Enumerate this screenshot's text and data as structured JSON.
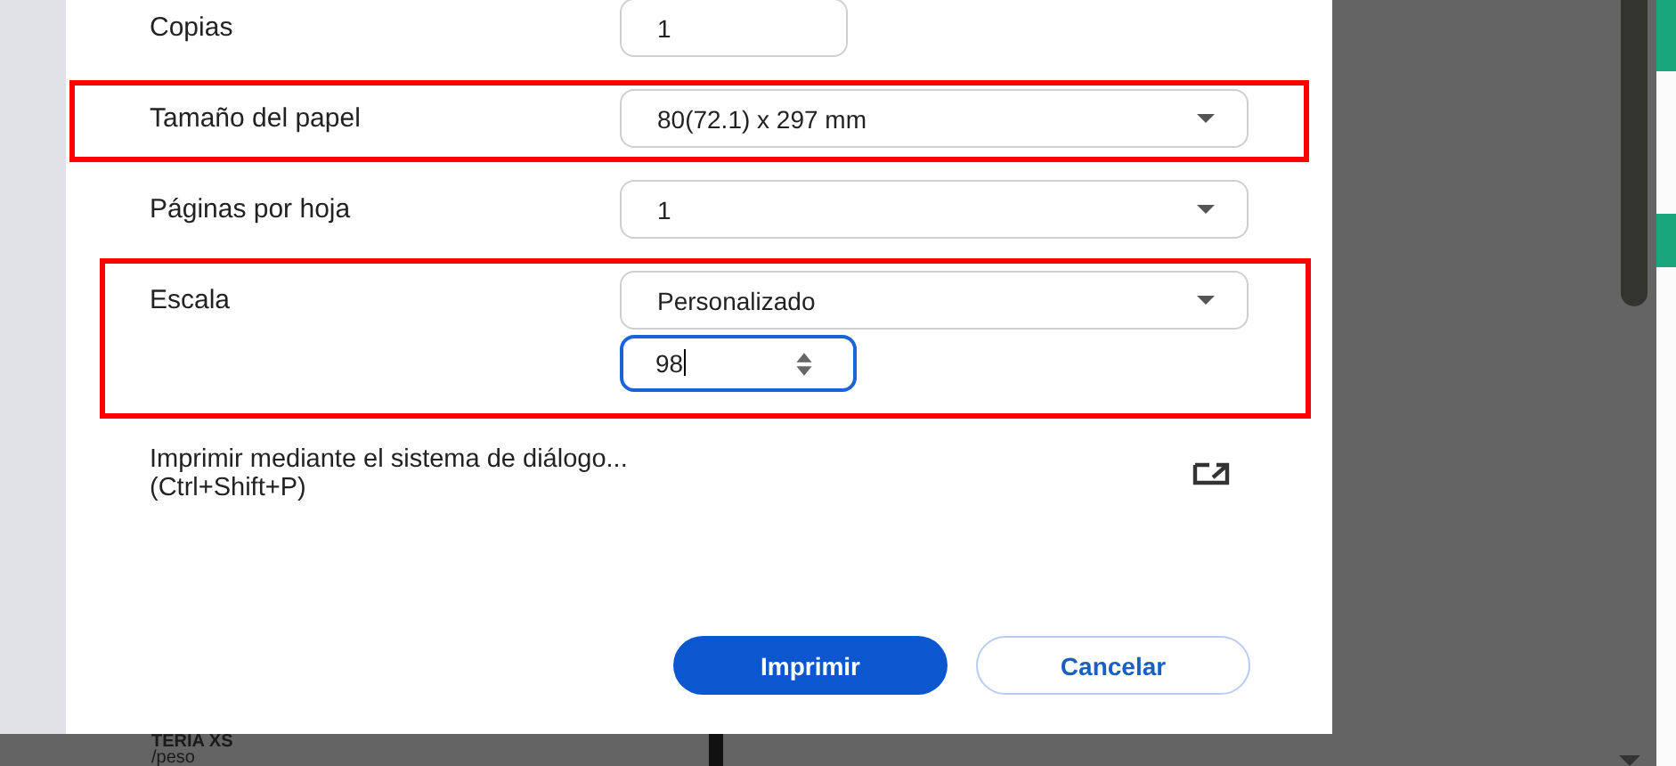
{
  "settings": [
    {
      "kind": "text",
      "label": "Copias",
      "value": "1",
      "highlighted": false
    },
    {
      "kind": "select",
      "label": "Tamaño del papel",
      "value": "80(72.1) x 297 mm",
      "highlighted": true
    },
    {
      "kind": "select",
      "label": "Páginas por hoja",
      "value": "1",
      "highlighted": false
    },
    {
      "kind": "select",
      "label": "Escala",
      "value": "Personalizado",
      "highlighted": true,
      "custom_value": "98"
    }
  ],
  "system_dialog": {
    "line_1": "Imprimir mediante el sistema de diálogo...",
    "line_2": "(Ctrl+Shift+P)"
  },
  "buttons": [
    {
      "label": "Imprimir",
      "kind": "primary"
    },
    {
      "label": "Cancelar",
      "kind": "secondary"
    }
  ],
  "background_page": {
    "lines": [
      "TERIA XS",
      "/peso"
    ]
  }
}
